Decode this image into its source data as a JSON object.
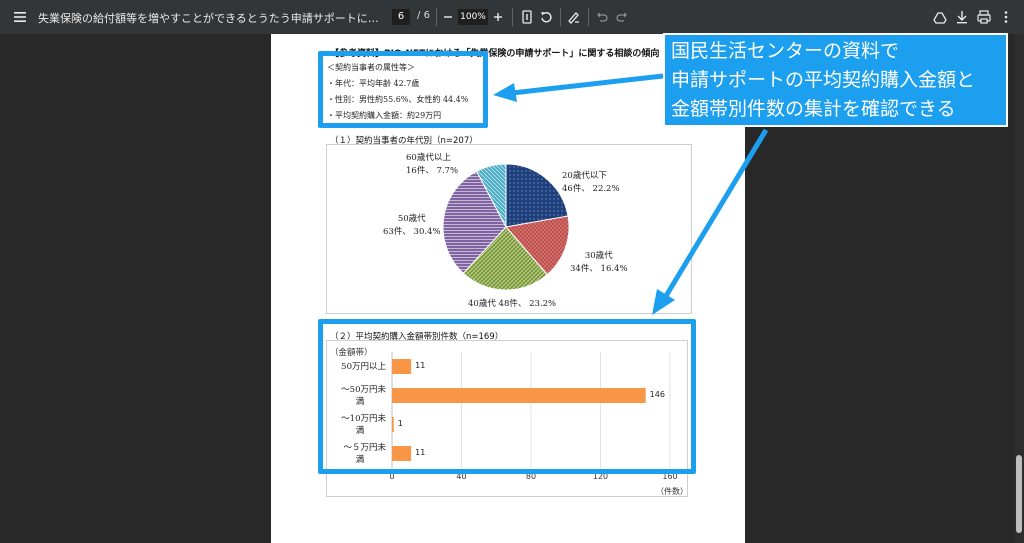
{
  "toolbar": {
    "title": "失業保険の給付額等を増やすことができるとうたう申請サポートに注意－不正受給を促す…",
    "current_page": "6",
    "page_separator": "/",
    "total_pages": "6",
    "zoom": "100%",
    "icons": [
      "menu-icon",
      "zoom-out-icon",
      "zoom-in-icon",
      "fit-page-icon",
      "rotate-icon",
      "annotate-icon",
      "undo-icon",
      "redo-icon",
      "drive-icon",
      "download-icon",
      "print-icon",
      "more-icon"
    ]
  },
  "document": {
    "heading": "【参考資料】PIO-NETにおける「失業保険の申請サポート」に関する相談の傾向",
    "attributes": {
      "title": "＜契約当事者の属性等＞",
      "lines": [
        "・年代：平均年齢 42.7歳",
        "・性別：男性約55.6%、女性約 44.4%",
        "・平均契約購入金額：約29万円"
      ]
    },
    "pie_section_title": "（１）契約当事者の年代別（n=207）",
    "bar_section_title": "（２）平均契約購入金額帯別件数（n=169）",
    "bar_axis_title": "（金額帯）",
    "bar_axis_unit": "（件数）"
  },
  "callout": {
    "lines": [
      "国民生活センターの資料で",
      "申請サポートの平均契約購入金額と",
      "金額帯別件数の集計を確認できる"
    ]
  },
  "colors": {
    "accent": "#1d9ff0",
    "bar": "#f79646",
    "pie_20s": "#1f3f7a",
    "pie_30s": "#c0504d",
    "pie_40s": "#9bbb59",
    "pie_50s": "#8064a2",
    "pie_60s": "#4bacc6"
  },
  "chart_data": [
    {
      "type": "pie",
      "title": "（１）契約当事者の年代別（n=207）",
      "slices": [
        {
          "name": "20歳代以下",
          "count": "46件",
          "percent": "22.2%",
          "value": 22.2
        },
        {
          "name": "30歳代",
          "count": "34件",
          "percent": "16.4%",
          "value": 16.4
        },
        {
          "name": "40歳代",
          "count": "48件",
          "percent": "23.2%",
          "value": 23.2
        },
        {
          "name": "50歳代",
          "count": "63件",
          "percent": "30.4%",
          "value": 30.4
        },
        {
          "name": "60歳代以上",
          "count": "16件",
          "percent": "7.7%",
          "value": 7.7
        }
      ]
    },
    {
      "type": "bar",
      "orientation": "horizontal",
      "title": "（２）平均契約購入金額帯別件数（n=169）",
      "ylabel": "（金額帯）",
      "xlabel": "（件数）",
      "categories": [
        [
          "50万円以上"
        ],
        [
          "～50万円未",
          "満"
        ],
        [
          "～10万円未",
          "満"
        ],
        [
          "～５万円未",
          "満"
        ]
      ],
      "values": [
        11,
        146,
        1,
        11
      ],
      "xlim": [
        0,
        160
      ],
      "xticks": [
        0,
        40,
        80,
        120,
        160
      ],
      "grid": true
    }
  ]
}
